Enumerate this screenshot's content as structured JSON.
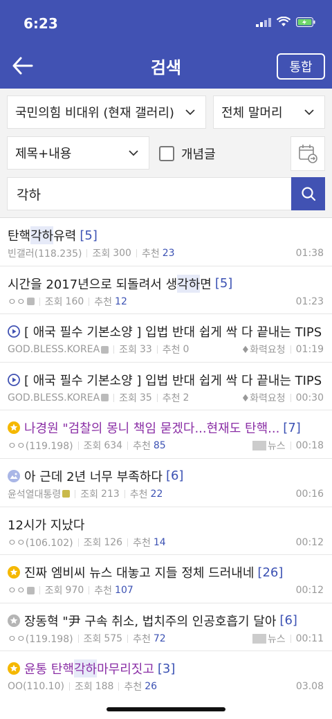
{
  "status": {
    "time": "6:23"
  },
  "header": {
    "title": "검색",
    "tonghap_label": "통합"
  },
  "filters": {
    "gallery_select": "국민의힘 비대위 (현재 갤러리)",
    "head_select": "전체 말머리",
    "type_select": "제목+내용",
    "concept_label": "개념글",
    "search_value": "각하"
  },
  "posts": [
    {
      "title_pre": "탄핵 ",
      "title_hl": "각하",
      "title_post": " 유력",
      "count": "[5]",
      "author": "빈갤러(118.235)",
      "views_label": "조회",
      "views": "300",
      "rec_label": "추천",
      "rec": "23",
      "tag": "",
      "time": "01:38",
      "icon": "",
      "purple": false
    },
    {
      "title_pre": "시간을 2017년으로 되돌려서 생",
      "title_hl": "각하",
      "title_post": "면",
      "count": "[5]",
      "author": "ㅇㅇ",
      "views_label": "조회",
      "views": "160",
      "rec_label": "추천",
      "rec": "12",
      "tag": "",
      "time": "01:23",
      "icon": "",
      "purple": false
    },
    {
      "title_pre": "[ 애국 필수 기본소양 ] 입법 반대 쉽게 싹 다 끝내는 TIPS",
      "title_hl": "",
      "title_post": "",
      "count": "",
      "author": "GOD.BLESS.KOREA",
      "views_label": "조회",
      "views": "33",
      "rec_label": "추천",
      "rec": "0",
      "tag": "♦화력요청",
      "time": "01:19",
      "icon": "play",
      "purple": false
    },
    {
      "title_pre": "[ 애국 필수 기본소양 ] 입법 반대 쉽게 싹 다 끝내는 TIPS",
      "title_hl": "",
      "title_post": "",
      "count": "",
      "author": "GOD.BLESS.KOREA",
      "views_label": "조회",
      "views": "35",
      "rec_label": "추천",
      "rec": "2",
      "tag": "♦화력요청",
      "time": "00:30",
      "icon": "play",
      "purple": false
    },
    {
      "title_pre": "나경원 \"검찰의 몽니 책임 묻겠다...현재도 탄핵...",
      "title_hl": "",
      "title_post": "",
      "count": "[7]",
      "author": "ㅇㅇ(119.198)",
      "views_label": "조회",
      "views": "634",
      "rec_label": "추천",
      "rec": "85",
      "tag": "뉴스",
      "time": "00:18",
      "icon": "star-yellow",
      "purple": true
    },
    {
      "title_pre": "아 근데 2년 너무 부족하다",
      "title_hl": "",
      "title_post": "",
      "count": "[6]",
      "author": "윤석열대통령",
      "views_label": "조회",
      "views": "213",
      "rec_label": "추천",
      "rec": "22",
      "tag": "",
      "time": "00:16",
      "icon": "image",
      "purple": false
    },
    {
      "title_pre": "12시가 지났다",
      "title_hl": "",
      "title_post": "",
      "count": "",
      "author": "ㅇㅇ(106.102)",
      "views_label": "조회",
      "views": "126",
      "rec_label": "추천",
      "rec": "14",
      "tag": "",
      "time": "00:12",
      "icon": "",
      "purple": false
    },
    {
      "title_pre": "진짜 엠비씨 뉴스 대놓고 지들 정체 드러내네",
      "title_hl": "",
      "title_post": "",
      "count": "[26]",
      "author": "ㅇㅇ",
      "views_label": "조회",
      "views": "970",
      "rec_label": "추천",
      "rec": "107",
      "tag": "",
      "time": "00:12",
      "icon": "star-yellow",
      "purple": false
    },
    {
      "title_pre": "장동혁 \"尹 구속 취소, 법치주의 인공호흡기 달아",
      "title_hl": "",
      "title_post": "",
      "count": "[6]",
      "author": "ㅇㅇ(119.198)",
      "views_label": "조회",
      "views": "575",
      "rec_label": "추천",
      "rec": "72",
      "tag": "뉴스",
      "time": "00:11",
      "icon": "star-gray",
      "purple": false
    },
    {
      "title_pre": "윤통 탄핵",
      "title_hl": "각하",
      "title_post": " 마무리짓고",
      "count": "[3]",
      "author": "OO(110.10)",
      "views_label": "조회",
      "views": "188",
      "rec_label": "추천",
      "rec": "26",
      "tag": "",
      "time": "03.08",
      "icon": "star-yellow",
      "purple": true
    }
  ]
}
